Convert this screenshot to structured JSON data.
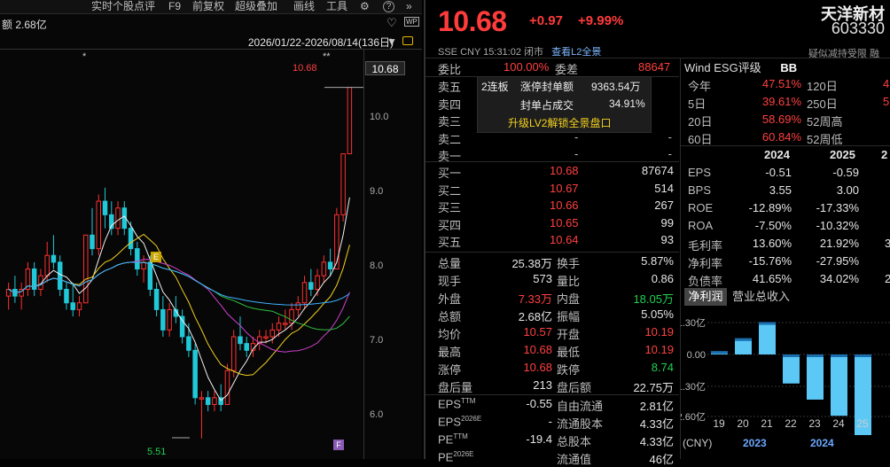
{
  "toolbar": {
    "items": [
      "实时个股点评",
      "F9",
      "前复权",
      "超级叠加",
      "画线",
      "工具"
    ],
    "wp_label": "WP"
  },
  "left": {
    "amount_label": "额 2.68亿",
    "range_label": "2026/01/22-2026/08/14(136日)",
    "price_ticks": [
      "10.0",
      "9.0",
      "8.0",
      "7.0",
      "6.0"
    ],
    "current_price_tag": "10.68",
    "max_marker": "10.68",
    "min_marker": "5.51",
    "star_markers": [
      "*",
      "**"
    ],
    "event_markers": [
      "E",
      "F"
    ]
  },
  "chart_data": {
    "type": "candlestick",
    "period": "2026/01/22-2026/08/14",
    "count": 136,
    "ylim": [
      5.3,
      11.1
    ],
    "high_marker": 10.68,
    "low_marker": 5.51,
    "candles": [
      [
        7.6,
        7.8,
        7.4,
        7.7
      ],
      [
        7.7,
        7.9,
        7.5,
        7.6
      ],
      [
        7.6,
        7.8,
        7.4,
        7.7
      ],
      [
        7.7,
        8.1,
        7.6,
        8.0
      ],
      [
        8.0,
        8.1,
        7.6,
        7.7
      ],
      [
        7.7,
        8.0,
        7.6,
        7.9
      ],
      [
        7.9,
        8.4,
        7.8,
        8.2
      ],
      [
        8.2,
        8.5,
        8.0,
        8.1
      ],
      [
        8.1,
        8.2,
        7.6,
        7.7
      ],
      [
        7.7,
        7.8,
        7.4,
        7.5
      ],
      [
        7.5,
        7.8,
        7.3,
        7.4
      ],
      [
        7.4,
        7.6,
        7.3,
        7.5
      ],
      [
        7.5,
        8.5,
        7.5,
        8.5
      ],
      [
        8.5,
        8.9,
        8.2,
        8.3
      ],
      [
        8.3,
        9.1,
        8.2,
        9.0
      ],
      [
        9.0,
        9.2,
        8.6,
        8.8
      ],
      [
        8.8,
        9.0,
        8.5,
        8.6
      ],
      [
        8.6,
        9.0,
        8.5,
        8.9
      ],
      [
        8.9,
        9.0,
        8.5,
        8.6
      ],
      [
        8.6,
        8.7,
        8.2,
        8.3
      ],
      [
        8.3,
        8.4,
        7.9,
        8.0
      ],
      [
        8.0,
        8.2,
        7.8,
        8.1
      ],
      [
        8.1,
        8.2,
        7.6,
        7.7
      ],
      [
        7.7,
        7.8,
        7.3,
        7.4
      ],
      [
        7.4,
        7.6,
        7.0,
        7.1
      ],
      [
        7.1,
        7.5,
        7.0,
        7.4
      ],
      [
        7.4,
        7.6,
        7.2,
        7.3
      ],
      [
        7.3,
        7.4,
        6.9,
        7.0
      ],
      [
        7.0,
        7.2,
        6.7,
        6.8
      ],
      [
        6.8,
        6.9,
        6.0,
        6.1
      ],
      [
        6.1,
        6.2,
        5.5,
        6.1
      ],
      [
        6.1,
        6.2,
        5.9,
        6.0
      ],
      [
        6.0,
        6.2,
        5.9,
        6.1
      ],
      [
        6.1,
        6.3,
        5.9,
        6.0
      ],
      [
        6.0,
        6.6,
        6.0,
        6.5
      ],
      [
        6.5,
        7.1,
        6.4,
        7.0
      ],
      [
        7.0,
        7.3,
        6.8,
        6.9
      ],
      [
        6.9,
        7.0,
        6.7,
        6.8
      ],
      [
        6.8,
        7.0,
        6.7,
        6.9
      ],
      [
        6.9,
        7.1,
        6.8,
        7.0
      ],
      [
        7.0,
        7.1,
        6.9,
        7.0
      ],
      [
        7.0,
        7.2,
        6.9,
        7.1
      ],
      [
        7.1,
        7.3,
        7.0,
        7.2
      ],
      [
        7.2,
        7.4,
        7.1,
        7.2
      ],
      [
        7.2,
        7.5,
        7.1,
        7.4
      ],
      [
        7.4,
        7.6,
        7.3,
        7.5
      ],
      [
        7.5,
        7.9,
        7.4,
        7.8
      ],
      [
        7.8,
        8.0,
        7.6,
        7.7
      ],
      [
        7.7,
        8.0,
        7.6,
        7.9
      ],
      [
        7.9,
        8.2,
        7.8,
        8.1
      ],
      [
        8.1,
        8.3,
        7.9,
        8.0
      ],
      [
        8.0,
        8.9,
        8.0,
        8.8
      ],
      [
        8.8,
        9.7,
        8.7,
        9.7
      ],
      [
        9.7,
        10.68,
        9.7,
        10.68
      ]
    ],
    "ma_lines": [
      {
        "name": "MA5",
        "color": "#f2f2f2"
      },
      {
        "name": "MA10",
        "color": "#f0d020"
      },
      {
        "name": "MA20",
        "color": "#d040d0"
      },
      {
        "name": "MA30",
        "color": "#30c040"
      },
      {
        "name": "MA60",
        "color": "#40b0ff"
      }
    ]
  },
  "quote": {
    "price": "10.68",
    "change": "+0.97",
    "change_pct": "+9.99%",
    "name": "天洋新材",
    "code": "603330",
    "info_line": "SSE  CNY  15:31:02  闭市",
    "l2_link": "查看L2全景",
    "risk_line": "疑似减持受限  融"
  },
  "orderbook": {
    "commission_ratio_label": "委比",
    "commission_ratio": "100.00%",
    "commission_diff_label": "委差",
    "commission_diff": "88647",
    "sells": [
      {
        "label": "卖五",
        "price": "",
        "vol": ""
      },
      {
        "label": "卖四",
        "price": "",
        "vol": ""
      },
      {
        "label": "卖三",
        "price": "",
        "vol": ""
      },
      {
        "label": "卖二",
        "price": "-",
        "vol": "-"
      },
      {
        "label": "卖一",
        "price": "-",
        "vol": "-"
      }
    ],
    "buys": [
      {
        "label": "买一",
        "price": "10.68",
        "vol": "87674"
      },
      {
        "label": "买二",
        "price": "10.67",
        "vol": "514"
      },
      {
        "label": "买三",
        "price": "10.66",
        "vol": "267"
      },
      {
        "label": "买四",
        "price": "10.65",
        "vol": "99"
      },
      {
        "label": "买五",
        "price": "10.64",
        "vol": "93"
      }
    ],
    "l2": {
      "streak": "2连板",
      "seal_label": "涨停封单额",
      "seal_value": "9363.54万",
      "ratio_label": "封单占成交",
      "ratio_value": "34.91%",
      "upgrade": "升级LV2解锁全景盘口"
    }
  },
  "stats": [
    {
      "l1": "总量",
      "v1": "25.38万",
      "c1": "white",
      "l2": "换手",
      "v2": "5.87%",
      "c2": "white"
    },
    {
      "l1": "现手",
      "v1": "573",
      "c1": "white",
      "l2": "量比",
      "v2": "0.86",
      "c2": "white"
    },
    {
      "l1": "外盘",
      "v1": "7.33万",
      "c1": "red",
      "l2": "内盘",
      "v2": "18.05万",
      "c2": "green"
    },
    {
      "l1": "总额",
      "v1": "2.68亿",
      "c1": "white",
      "l2": "振幅",
      "v2": "5.05%",
      "c2": "white"
    },
    {
      "l1": "均价",
      "v1": "10.57",
      "c1": "red",
      "l2": "开盘",
      "v2": "10.19",
      "c2": "red"
    },
    {
      "l1": "最高",
      "v1": "10.68",
      "c1": "red",
      "l2": "最低",
      "v2": "10.19",
      "c2": "red"
    },
    {
      "l1": "涨停",
      "v1": "10.68",
      "c1": "red",
      "l2": "跌停",
      "v2": "8.74",
      "c2": "green"
    },
    {
      "l1": "盘后量",
      "v1": "213",
      "c1": "white",
      "l2": "盘后额",
      "v2": "22.75万",
      "c2": "white"
    }
  ],
  "fundamentals": [
    {
      "l1": "EPS",
      "s1": "TTM",
      "v1": "-0.55",
      "l2": "自由流通",
      "v2": "2.81亿"
    },
    {
      "l1": "EPS",
      "s1": "2026E",
      "v1": "-",
      "l2": "流通股本",
      "v2": "4.33亿"
    },
    {
      "l1": "PE",
      "s1": "TTM",
      "v1": "-19.4",
      "l2": "总股本",
      "v2": "4.33亿"
    },
    {
      "l1": "PE",
      "s1": "2026E",
      "v1": "",
      "l2": "流通值",
      "v2": "46亿"
    }
  ],
  "wind": {
    "title": "Wind  ESG评级",
    "rating": "BB",
    "periods": [
      {
        "l1": "今年",
        "v1": "47.51%",
        "l2": "120日",
        "v2": "4"
      },
      {
        "l1": "5日",
        "v1": "39.61%",
        "l2": "250日",
        "v2": "5"
      },
      {
        "l1": "20日",
        "v1": "58.69%",
        "l2": "52周高",
        "v2": ""
      },
      {
        "l1": "60日",
        "v1": "60.84%",
        "l2": "52周低",
        "v2": ""
      }
    ],
    "years": [
      "2024",
      "2025",
      "2"
    ],
    "metrics": [
      {
        "name": "EPS",
        "a": "-0.51",
        "b": "-0.59",
        "c": ""
      },
      {
        "name": "BPS",
        "a": "3.55",
        "b": "3.00",
        "c": ""
      },
      {
        "name": "ROE",
        "a": "-12.89%",
        "b": "-17.33%",
        "c": ""
      },
      {
        "name": "ROA",
        "a": "-7.50%",
        "b": "-10.32%",
        "c": ""
      },
      {
        "name": "毛利率",
        "a": "13.60%",
        "b": "21.92%",
        "c": "3"
      },
      {
        "name": "净利率",
        "a": "-15.76%",
        "b": "-27.95%",
        "c": ""
      },
      {
        "name": "负债率",
        "a": "41.65%",
        "b": "34.02%",
        "c": "2"
      }
    ],
    "tab_active": "净利润",
    "tab_other": "营业总收入"
  },
  "mini_chart": {
    "y_ticks": [
      "1.30亿",
      "0.00",
      "-1.30亿",
      "-2.60亿"
    ],
    "x_ticks": [
      "19",
      "20",
      "21",
      "22",
      "23",
      "24",
      "25"
    ],
    "years": [
      "2023",
      "2024"
    ],
    "currency": "(CNY)",
    "bars": [
      0.1,
      0.5,
      1.0,
      -0.9,
      -1.4,
      -1.9,
      -2.5
    ]
  }
}
